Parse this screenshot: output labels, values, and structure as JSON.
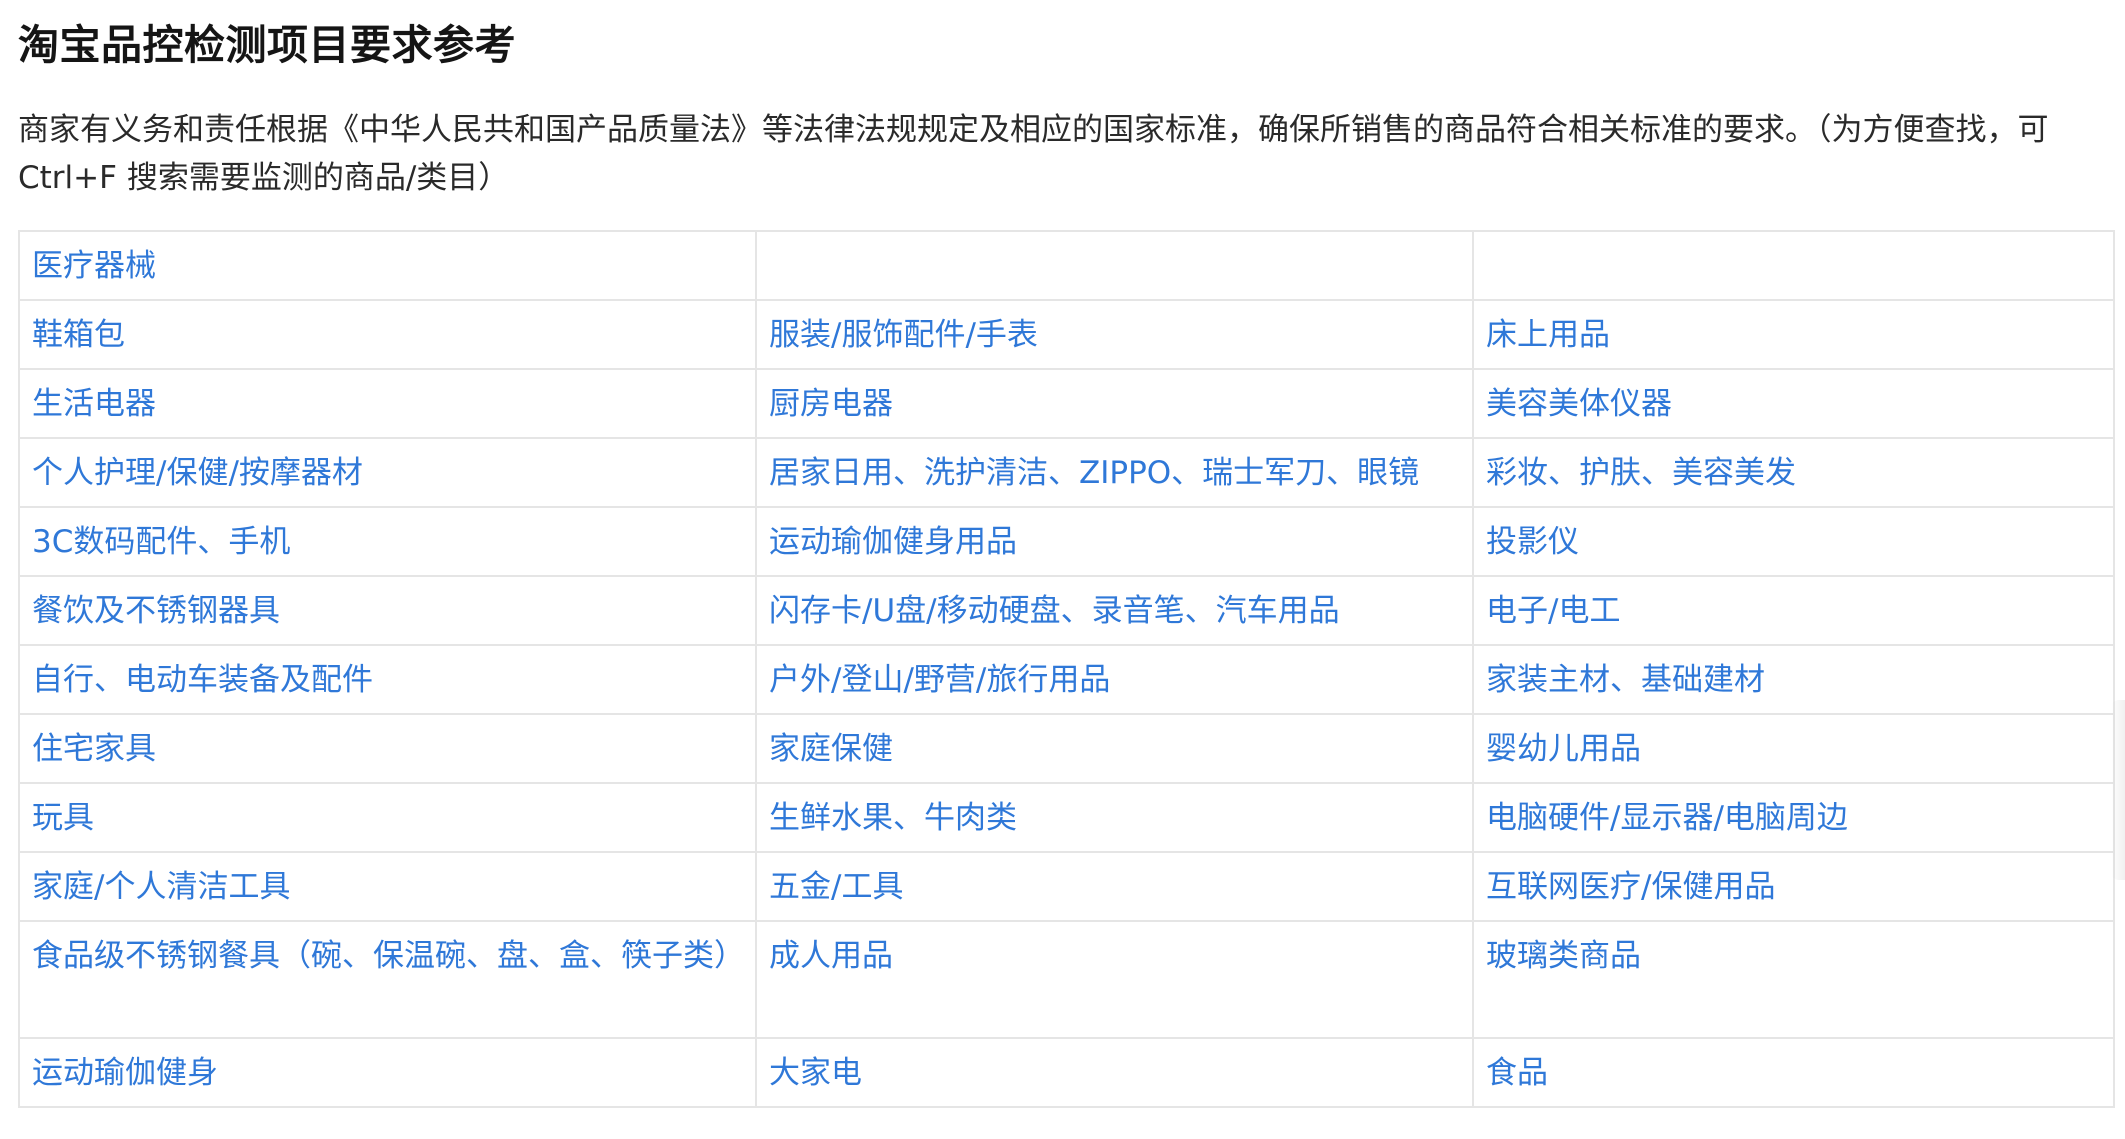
{
  "page": {
    "title": "淘宝品控检测项目要求参考",
    "intro": "商家有义务和责任根据《中华人民共和国产品质量法》等法律法规规定及相应的国家标准，确保所销售的商品符合相关标准的要求。（为方便查找，可Ctrl+F 搜索需要监测的商品/类目）"
  },
  "colors": {
    "link": "#2f78d8",
    "border": "#e5e5e5",
    "title": "#151515"
  },
  "table": {
    "rows": [
      [
        "医疗器械",
        "",
        ""
      ],
      [
        "鞋箱包",
        "服装/服饰配件/手表",
        "床上用品"
      ],
      [
        "生活电器",
        "厨房电器",
        "美容美体仪器"
      ],
      [
        "个人护理/保健/按摩器材",
        "居家日用、洗护清洁、ZIPPO、瑞士军刀、眼镜",
        "彩妆、护肤、美容美发"
      ],
      [
        "3C数码配件、手机",
        "运动瑜伽健身用品",
        "投影仪"
      ],
      [
        "餐饮及不锈钢器具",
        "闪存卡/U盘/移动硬盘、录音笔、汽车用品",
        "电子/电工"
      ],
      [
        "自行、电动车装备及配件",
        "户外/登山/野营/旅行用品",
        "家装主材、基础建材"
      ],
      [
        "住宅家具",
        "家庭保健",
        "婴幼儿用品"
      ],
      [
        "玩具",
        "生鲜水果、牛肉类",
        "电脑硬件/显示器/电脑周边"
      ],
      [
        "家庭/个人清洁工具",
        "五金/工具",
        "互联网医疗/保健用品"
      ],
      [
        "食品级不锈钢餐具（碗、保温碗、盘、盒、筷子类）",
        "成人用品",
        "玻璃类商品"
      ],
      [
        "运动瑜伽健身",
        "大家电",
        "食品"
      ]
    ]
  }
}
